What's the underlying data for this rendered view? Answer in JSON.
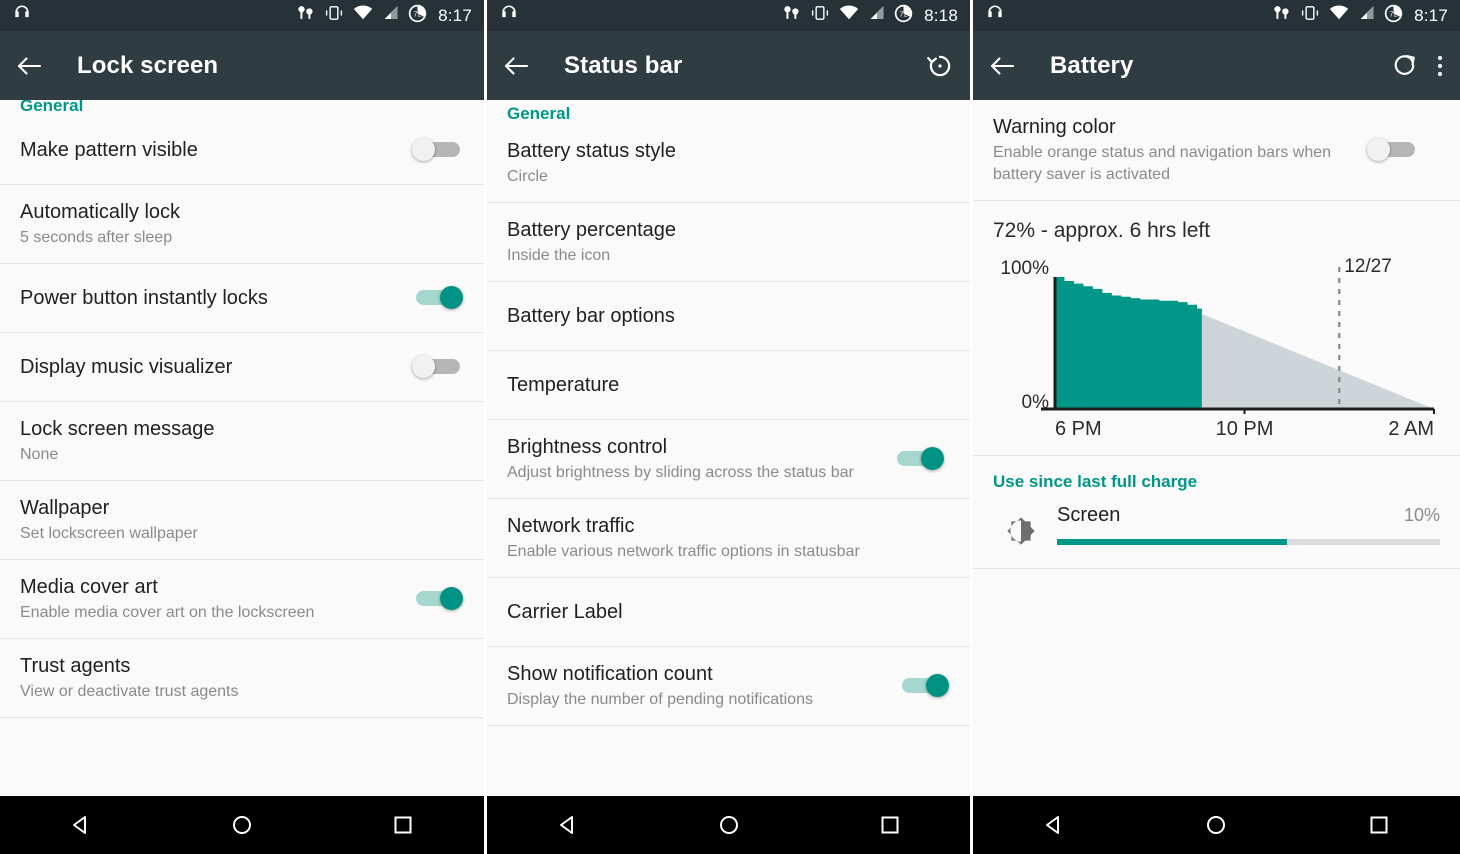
{
  "theme": {
    "accent": "#009688",
    "action_bar_bg": "#2f3c42",
    "status_bar_bg": "#263238",
    "page_bg": "#fafafa",
    "nav_bar_bg": "#000000",
    "switch_on_thumb": "#009283",
    "switch_on_track": "#a5d6cf",
    "switch_off_track": "#b6b6b6",
    "chart_used": "#009688",
    "chart_projection": "#ced5d8"
  },
  "nav_bar": {
    "back_label": "Back",
    "home_label": "Home",
    "recents_label": "Recent apps"
  },
  "status_bar": {
    "icons": [
      "headset-icon",
      "earbuds-icon",
      "vibrate-icon",
      "wifi-icon",
      "signal-icon",
      "battery-circle-icon"
    ],
    "battery_level": "72"
  },
  "screens": [
    {
      "id": "lock-screen",
      "status_time": "8:17",
      "title": "Lock screen",
      "actions": [],
      "section_header": "General",
      "rows": [
        {
          "title": "Make pattern visible",
          "sub": "",
          "control": "switch",
          "on": false
        },
        {
          "title": "Automatically lock",
          "sub": "5 seconds after sleep",
          "control": "none"
        },
        {
          "title": "Power button instantly locks",
          "sub": "",
          "control": "switch",
          "on": true
        },
        {
          "title": "Display music visualizer",
          "sub": "",
          "control": "switch",
          "on": false
        },
        {
          "title": "Lock screen message",
          "sub": "None",
          "control": "none"
        },
        {
          "title": "Wallpaper",
          "sub": "Set lockscreen wallpaper",
          "control": "none"
        },
        {
          "title": "Media cover art",
          "sub": "Enable media cover art on the lockscreen",
          "control": "switch",
          "on": true
        },
        {
          "title": "Trust agents",
          "sub": "View or deactivate trust agents",
          "control": "none"
        }
      ]
    },
    {
      "id": "status-bar-settings",
      "status_time": "8:18",
      "title": "Status bar",
      "actions": [
        {
          "name": "restore-defaults-icon",
          "label": "Restore"
        }
      ],
      "section_header": "General",
      "rows": [
        {
          "title": "Battery status style",
          "sub": "Circle",
          "control": "none"
        },
        {
          "title": "Battery percentage",
          "sub": "Inside the icon",
          "control": "none"
        },
        {
          "title": "Battery bar options",
          "sub": "",
          "control": "none"
        },
        {
          "title": "Temperature",
          "sub": "",
          "control": "none"
        },
        {
          "title": "Brightness control",
          "sub": "Adjust brightness by sliding across the status bar",
          "control": "switch",
          "on": true
        },
        {
          "title": "Network traffic",
          "sub": "Enable various network traffic options in statusbar",
          "control": "none"
        },
        {
          "title": "Carrier Label",
          "sub": "",
          "control": "none"
        },
        {
          "title": "Show notification count",
          "sub": "Display the number of pending notifications",
          "control": "switch",
          "on": true
        }
      ]
    },
    {
      "id": "battery",
      "status_time": "8:17",
      "title": "Battery",
      "actions": [
        {
          "name": "refresh-icon",
          "label": "Refresh"
        },
        {
          "name": "overflow-menu-icon",
          "label": "More options"
        }
      ],
      "rows": [
        {
          "title": "Warning color",
          "sub": "Enable orange status and navigation bars when battery saver is activated",
          "control": "switch",
          "on": false
        }
      ],
      "chart_summary": "72% - approx. 6 hrs left",
      "use_section_header": "Use since last full charge",
      "use_items": [
        {
          "icon": "brightness-icon",
          "name": "Screen",
          "percent": "10%",
          "bar_fill": 60
        }
      ]
    }
  ],
  "chart_data": {
    "type": "area",
    "title": "72% - approx. 6 hrs left",
    "xlabel": "",
    "ylabel": "",
    "ylim": [
      0,
      100
    ],
    "ytick_labels": [
      "100%",
      "0%"
    ],
    "xtick_labels": [
      "6 PM",
      "10 PM",
      "2 AM"
    ],
    "xtick_positions_hours": [
      18,
      22,
      26
    ],
    "grid": false,
    "legend": false,
    "annotations": [
      {
        "text": "12/27",
        "type": "vertical-dashed-line",
        "x_hours": 24
      }
    ],
    "series": [
      {
        "name": "Battery used",
        "color": "#009688",
        "x_hours": [
          18.0,
          18.2,
          18.4,
          18.6,
          18.8,
          19.0,
          19.2,
          19.4,
          19.6,
          19.8,
          20.0,
          20.2,
          20.4,
          20.6,
          20.8,
          21.0,
          21.1
        ],
        "values": [
          100,
          97,
          95,
          93,
          91,
          88,
          86,
          85,
          84,
          83,
          83,
          82,
          82,
          81,
          79,
          76,
          72
        ]
      },
      {
        "name": "Projected remaining",
        "color": "#ced5d8",
        "x_hours": [
          21.1,
          26.0
        ],
        "values": [
          72,
          0
        ]
      }
    ]
  }
}
